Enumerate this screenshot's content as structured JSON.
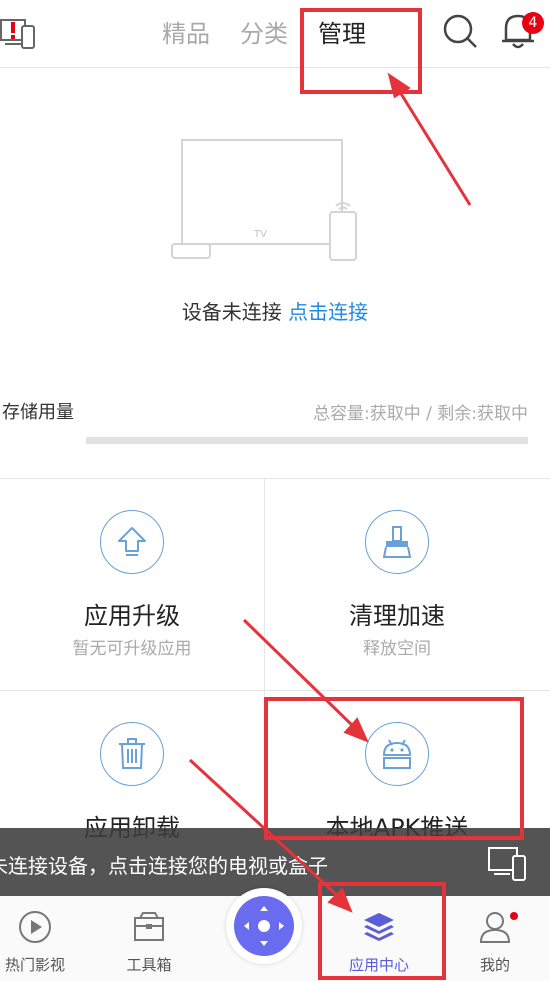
{
  "header": {
    "tabs": [
      {
        "label": "精品",
        "active": false
      },
      {
        "label": "分类",
        "active": false
      },
      {
        "label": "管理",
        "active": true
      }
    ],
    "notification_count": "4",
    "icons": [
      "cast-icon",
      "search-icon",
      "bell-icon"
    ]
  },
  "device": {
    "tv_label": "TV",
    "status_text": "设备未连接",
    "connect_link": "点击连接"
  },
  "storage": {
    "label": "存储用量",
    "info": "总容量:获取中 / 剩余:获取中"
  },
  "tiles": [
    {
      "title": "应用升级",
      "subtitle": "暂无可升级应用",
      "icon": "upgrade-icon"
    },
    {
      "title": "清理加速",
      "subtitle": "释放空间",
      "icon": "broom-icon"
    },
    {
      "title": "应用卸载",
      "subtitle": "",
      "icon": "trash-icon"
    },
    {
      "title": "本地APK推送",
      "subtitle": "",
      "icon": "android-icon"
    }
  ],
  "toast": {
    "text": "未连接设备，点击连接您的电视或盒子"
  },
  "bottom_nav": [
    {
      "label": "热门影视",
      "icon": "play-icon",
      "active": false
    },
    {
      "label": "工具箱",
      "icon": "toolbox-icon",
      "active": false
    },
    {
      "label": "应用中心",
      "icon": "layers-icon",
      "active": true
    },
    {
      "label": "我的",
      "icon": "profile-icon",
      "active": false
    }
  ],
  "colors": {
    "accent": "#5a5cd9",
    "link": "#1e88e5",
    "annotation": "#e5333c",
    "badge": "#e60012"
  }
}
